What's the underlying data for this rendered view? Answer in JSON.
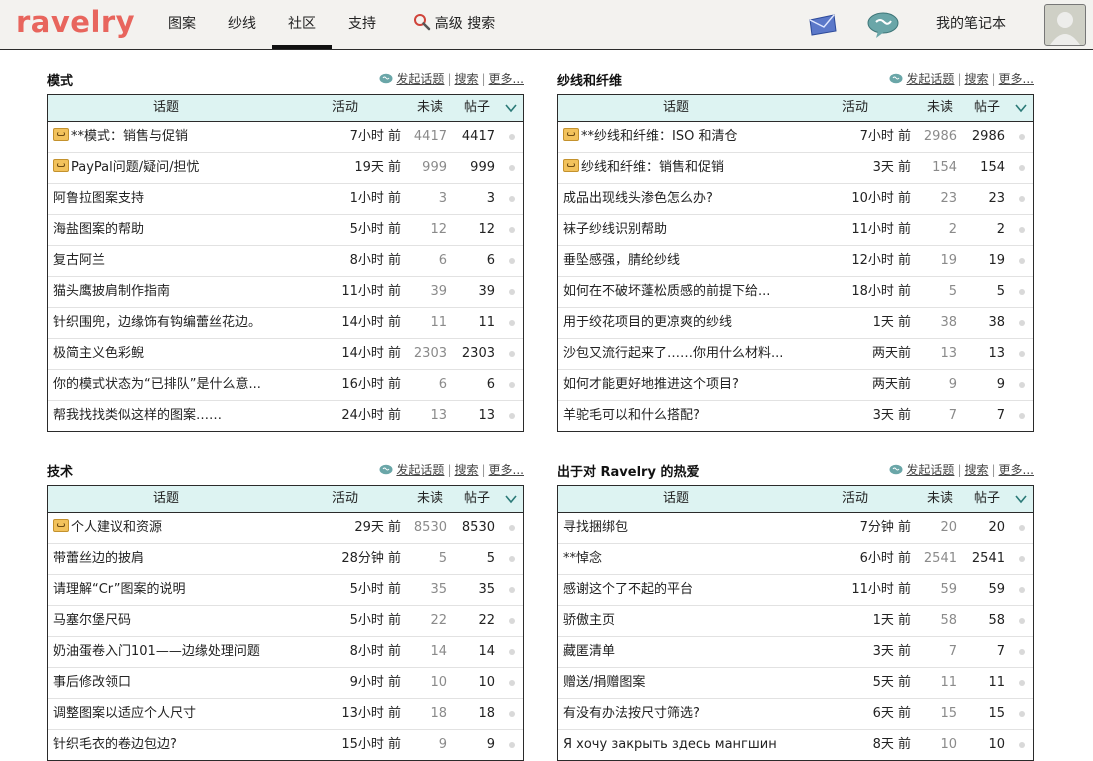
{
  "nav": {
    "logo": "ravelry",
    "items": [
      "图案",
      "纱线",
      "社区",
      "支持"
    ],
    "active_index": 2,
    "advanced_search": "高级 搜索",
    "notebook": "我的笔记本"
  },
  "common": {
    "start_topic": "发起话题",
    "search": "搜索",
    "more": "更多...",
    "col_topic": "话题",
    "col_activity": "活动",
    "col_unread": "未读",
    "col_posts": "帖子"
  },
  "panels": [
    {
      "title": "模式",
      "rows": [
        {
          "pinned": true,
          "topic": "**模式：销售与促销",
          "activity": "7小时 前",
          "unread": "4417",
          "posts": "4417"
        },
        {
          "pinned": true,
          "topic": "PayPal问题/疑问/担忧",
          "activity": "19天 前",
          "unread": "999",
          "posts": "999"
        },
        {
          "pinned": false,
          "topic": "阿鲁拉图案支持",
          "activity": "1小时 前",
          "unread": "3",
          "posts": "3"
        },
        {
          "pinned": false,
          "topic": "海盐图案的帮助",
          "activity": "5小时 前",
          "unread": "12",
          "posts": "12"
        },
        {
          "pinned": false,
          "topic": "复古阿兰",
          "activity": "8小时 前",
          "unread": "6",
          "posts": "6"
        },
        {
          "pinned": false,
          "topic": "猫头鹰披肩制作指南",
          "activity": "11小时 前",
          "unread": "39",
          "posts": "39"
        },
        {
          "pinned": false,
          "topic": "针织围兜，边缘饰有钩编蕾丝花边。",
          "activity": "14小时 前",
          "unread": "11",
          "posts": "11"
        },
        {
          "pinned": false,
          "topic": "极简主义色彩鲵",
          "activity": "14小时 前",
          "unread": "2303",
          "posts": "2303"
        },
        {
          "pinned": false,
          "topic": "你的模式状态为“已排队”是什么意...",
          "activity": "16小时 前",
          "unread": "6",
          "posts": "6"
        },
        {
          "pinned": false,
          "topic": "帮我找找类似这样的图案……",
          "activity": "24小时 前",
          "unread": "13",
          "posts": "13"
        }
      ]
    },
    {
      "title": "纱线和纤维",
      "rows": [
        {
          "pinned": true,
          "topic": "**纱线和纤维：ISO 和清仓",
          "activity": "7小时 前",
          "unread": "2986",
          "posts": "2986"
        },
        {
          "pinned": true,
          "topic": "纱线和纤维：销售和促销",
          "activity": "3天 前",
          "unread": "154",
          "posts": "154"
        },
        {
          "pinned": false,
          "topic": "成品出现线头渗色怎么办?",
          "activity": "10小时 前",
          "unread": "23",
          "posts": "23"
        },
        {
          "pinned": false,
          "topic": "袜子纱线识别帮助",
          "activity": "11小时 前",
          "unread": "2",
          "posts": "2"
        },
        {
          "pinned": false,
          "topic": "垂坠感强，腈纶纱线",
          "activity": "12小时 前",
          "unread": "19",
          "posts": "19"
        },
        {
          "pinned": false,
          "topic": "如何在不破坏蓬松质感的前提下给...",
          "activity": "18小时 前",
          "unread": "5",
          "posts": "5"
        },
        {
          "pinned": false,
          "topic": "用于绞花项目的更凉爽的纱线",
          "activity": "1天 前",
          "unread": "38",
          "posts": "38"
        },
        {
          "pinned": false,
          "topic": "沙包又流行起来了……你用什么材料...",
          "activity": "两天前",
          "unread": "13",
          "posts": "13"
        },
        {
          "pinned": false,
          "topic": "如何才能更好地推进这个项目?",
          "activity": "两天前",
          "unread": "9",
          "posts": "9"
        },
        {
          "pinned": false,
          "topic": "羊驼毛可以和什么搭配?",
          "activity": "3天 前",
          "unread": "7",
          "posts": "7"
        }
      ]
    },
    {
      "title": "技术",
      "rows": [
        {
          "pinned": true,
          "topic": "个人建议和资源",
          "activity": "29天 前",
          "unread": "8530",
          "posts": "8530"
        },
        {
          "pinned": false,
          "topic": "带蕾丝边的披肩",
          "activity": "28分钟 前",
          "unread": "5",
          "posts": "5"
        },
        {
          "pinned": false,
          "topic": "请理解“Cr”图案的说明",
          "activity": "5小时 前",
          "unread": "35",
          "posts": "35"
        },
        {
          "pinned": false,
          "topic": "马塞尔堡尺码",
          "activity": "5小时 前",
          "unread": "22",
          "posts": "22"
        },
        {
          "pinned": false,
          "topic": "奶油蛋卷入门101——边缘处理问题",
          "activity": "8小时 前",
          "unread": "14",
          "posts": "14"
        },
        {
          "pinned": false,
          "topic": "事后修改领口",
          "activity": "9小时 前",
          "unread": "10",
          "posts": "10"
        },
        {
          "pinned": false,
          "topic": "调整图案以适应个人尺寸",
          "activity": "13小时 前",
          "unread": "18",
          "posts": "18"
        },
        {
          "pinned": false,
          "topic": "针织毛衣的卷边包边?",
          "activity": "15小时 前",
          "unread": "9",
          "posts": "9"
        }
      ]
    },
    {
      "title": "出于对 Ravelry 的热爱",
      "rows": [
        {
          "pinned": false,
          "topic": "寻找捆绑包",
          "activity": "7分钟 前",
          "unread": "20",
          "posts": "20"
        },
        {
          "pinned": false,
          "topic": "**悼念",
          "activity": "6小时 前",
          "unread": "2541",
          "posts": "2541"
        },
        {
          "pinned": false,
          "topic": "感谢这个了不起的平台",
          "activity": "11小时 前",
          "unread": "59",
          "posts": "59"
        },
        {
          "pinned": false,
          "topic": "骄傲主页",
          "activity": "1天 前",
          "unread": "58",
          "posts": "58"
        },
        {
          "pinned": false,
          "topic": "藏匿清单",
          "activity": "3天 前",
          "unread": "7",
          "posts": "7"
        },
        {
          "pinned": false,
          "topic": "赠送/捐赠图案",
          "activity": "5天 前",
          "unread": "11",
          "posts": "11"
        },
        {
          "pinned": false,
          "topic": "有没有办法按尺寸筛选?",
          "activity": "6天 前",
          "unread": "15",
          "posts": "15"
        },
        {
          "pinned": false,
          "topic": "Я хочу закрыть здесь мангшин",
          "activity": "8天 前",
          "unread": "10",
          "posts": "10"
        }
      ]
    }
  ]
}
